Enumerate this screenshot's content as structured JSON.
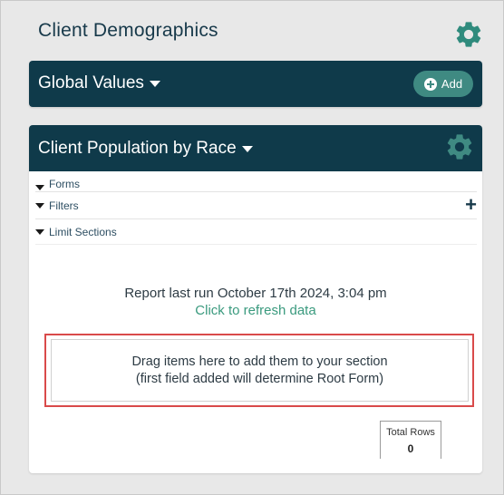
{
  "page": {
    "title": "Client Demographics"
  },
  "global_values": {
    "title": "Global Values",
    "add_label": "Add"
  },
  "report": {
    "title": "Client Population by Race",
    "sections": {
      "forms": "Forms",
      "filters": "Filters",
      "limit_sections": "Limit Sections"
    },
    "last_run": "Report last run October 17th 2024, 3:04 pm",
    "refresh_link": "Click to refresh data",
    "drop_zone": {
      "line1": "Drag items here to add them to your section",
      "line2": "(first field added will determine Root Form)"
    },
    "total_rows": {
      "label": "Total Rows",
      "value": "0"
    }
  },
  "colors": {
    "header_bg": "#0f3a4a",
    "accent_green": "#3f8a82",
    "link_green": "#3a9a7e",
    "highlight_red": "#d94a4a"
  },
  "icons": {
    "settings": "gear-icon",
    "add": "plus-circle-icon",
    "dropdown": "caret-down-icon",
    "add_filter": "plus-icon"
  }
}
